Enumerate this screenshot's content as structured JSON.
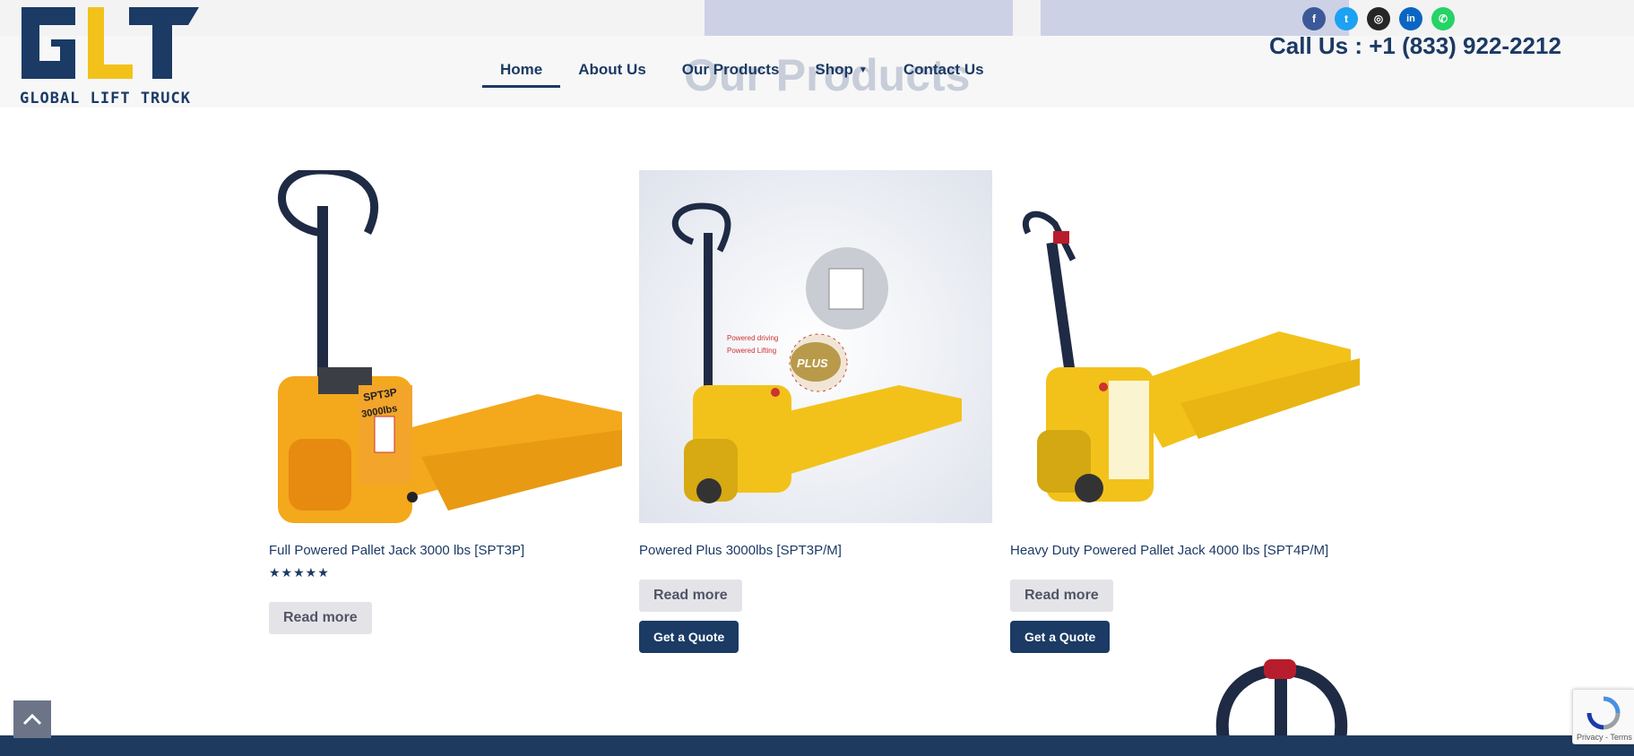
{
  "brand": {
    "logo_letters": "GLT",
    "logo_text": "GLOBAL LIFT TRUCK"
  },
  "nav": {
    "items": [
      {
        "label": "Home",
        "active": true
      },
      {
        "label": "About Us",
        "active": false
      },
      {
        "label": "Our Products",
        "active": false
      },
      {
        "label": "Shop",
        "active": false,
        "has_dropdown": true
      },
      {
        "label": "Contact Us",
        "active": false
      }
    ]
  },
  "header": {
    "ghost_title": "Our Products",
    "call": "Call Us : +1 (833) 922-2212"
  },
  "social": [
    {
      "name": "facebook-icon",
      "glyph": "f",
      "color": "#3b5998"
    },
    {
      "name": "twitter-icon",
      "glyph": "t",
      "color": "#1da1f2"
    },
    {
      "name": "instagram-icon",
      "glyph": "◎",
      "color": "#262626"
    },
    {
      "name": "linkedin-icon",
      "glyph": "in",
      "color": "#0a66c2"
    },
    {
      "name": "whatsapp-icon",
      "glyph": "✆",
      "color": "#25d366"
    }
  ],
  "products": [
    {
      "title": "Full Powered Pallet Jack 3000 lbs [SPT3P]",
      "rating": "★★★★★",
      "read_more": "Read more",
      "quote": ""
    },
    {
      "title": "Powered Plus 3000lbs [SPT3P/M]",
      "rating": "",
      "read_more": "Read more",
      "quote": "Get a Quote"
    },
    {
      "title": "Heavy Duty Powered Pallet Jack 4000 lbs [SPT4P/M]",
      "rating": "",
      "read_more": "Read more",
      "quote": "Get a Quote"
    }
  ],
  "product_image_text": {
    "model_label": "SPT3P",
    "capacity_label": "3000lbs",
    "powered_driving": "Powered driving",
    "powered_lifting": "Powered Lifting",
    "plus_badge": "PLUS"
  },
  "recaptcha": {
    "terms": "Privacy - Terms"
  },
  "colors": {
    "brand_blue": "#1b3a64",
    "brand_yellow": "#f2c21b",
    "pallet_yellow": "#f4a81c"
  }
}
